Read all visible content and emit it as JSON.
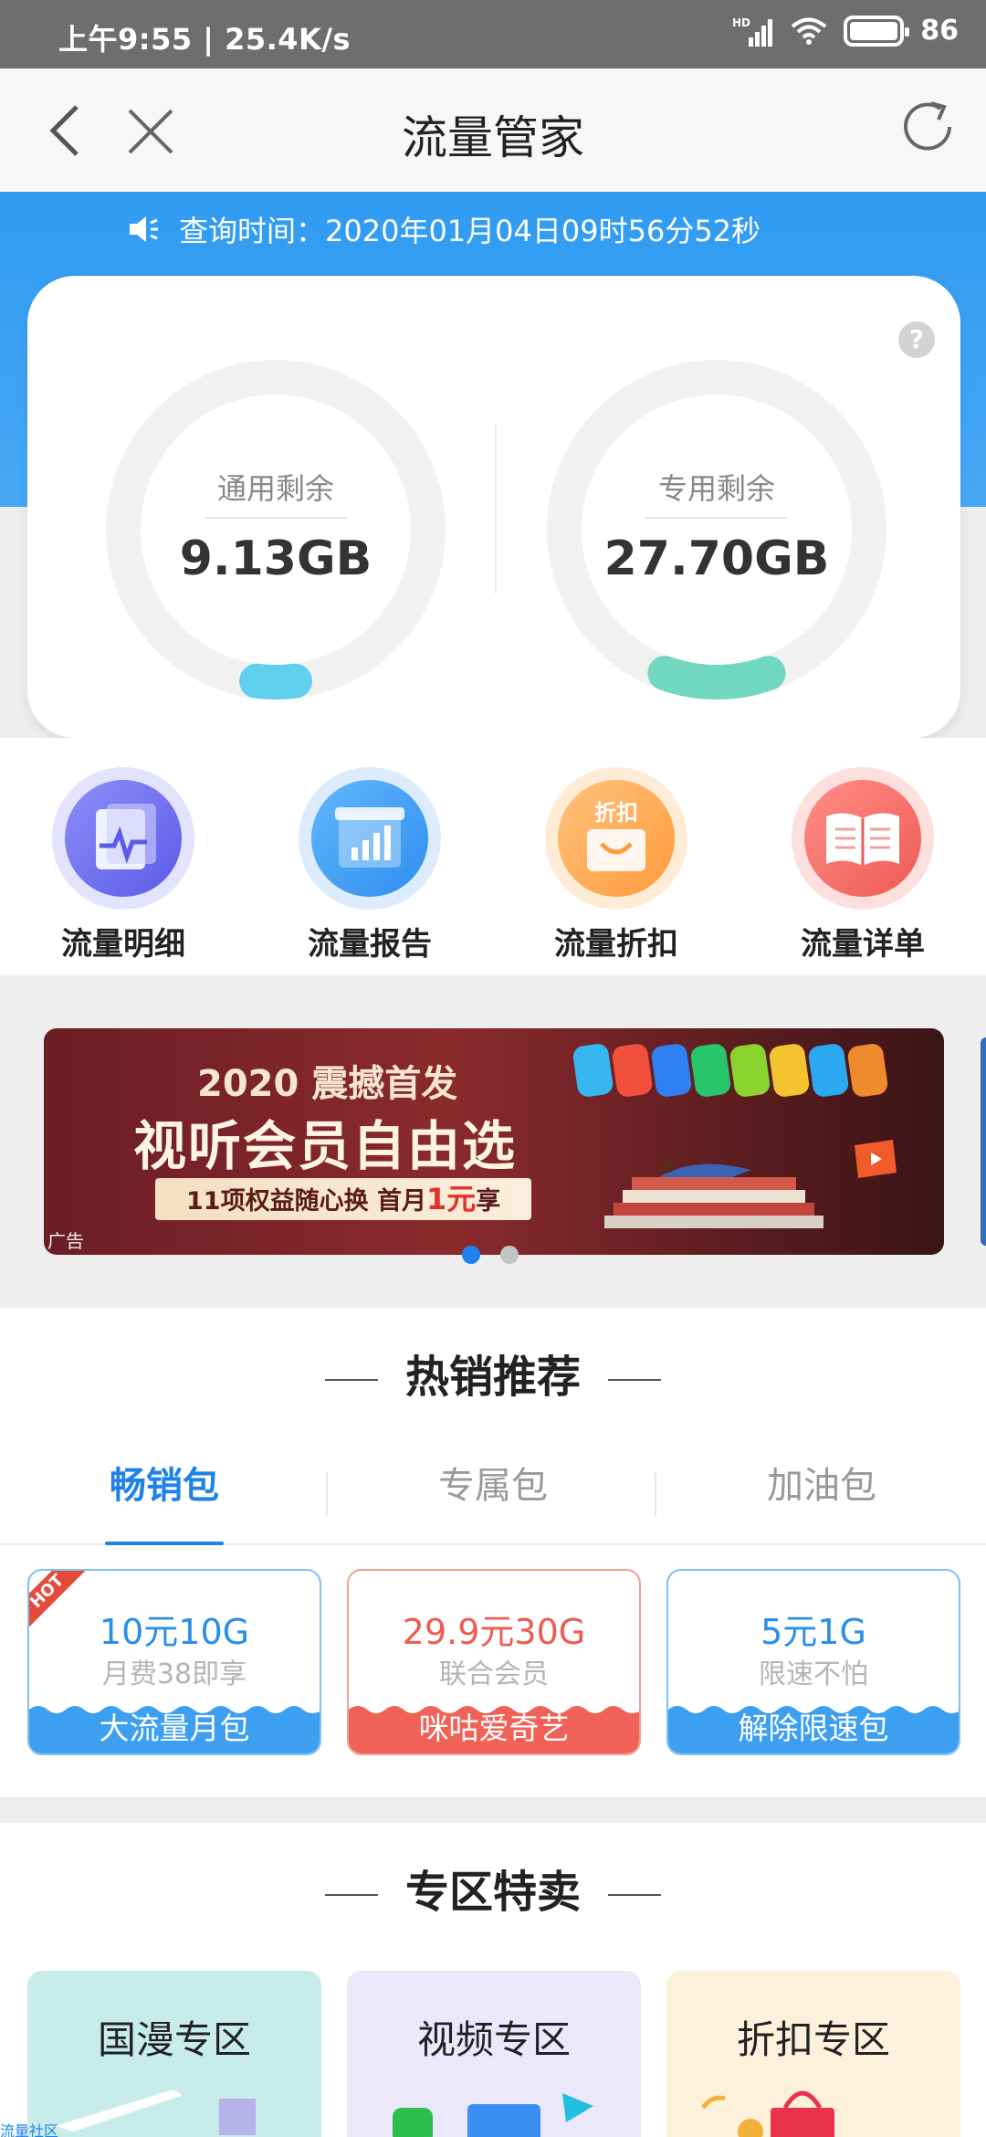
{
  "status_bar": {
    "time_speed": "上午9:55 | 25.4K/s",
    "battery": "86"
  },
  "title_bar": {
    "title": "流量管家"
  },
  "query": {
    "text": "查询时间：2020年01月04日09时56分52秒"
  },
  "gauges": [
    {
      "label": "通用剩余",
      "value": "9.13GB",
      "color": "#5fd0ee",
      "fraction": 0.04
    },
    {
      "label": "专用剩余",
      "value": "27.70GB",
      "color": "#72d8c0",
      "fraction": 0.11
    }
  ],
  "help_icon": "?",
  "quick_actions": [
    {
      "label": "流量明细",
      "icon": "heartbeat-doc-icon",
      "color": "#6b6ff0"
    },
    {
      "label": "流量报告",
      "icon": "bar-chart-icon",
      "color": "#3aa1f4"
    },
    {
      "label": "流量折扣",
      "icon": "discount-bag-icon",
      "badge": "折扣",
      "color": "#ffa74b"
    },
    {
      "label": "流量详单",
      "icon": "open-book-icon",
      "color": "#f7706b"
    }
  ],
  "banner": {
    "line1": "2020 震撼首发",
    "line2": "视听会员自由选",
    "line3_prefix": "11项权益随心换  首月",
    "line3_highlight": "1元",
    "line3_suffix": "享",
    "ad_label": "广告",
    "active_dot": 0
  },
  "hot": {
    "title": "热销推荐",
    "tabs": [
      "畅销包",
      "专属包",
      "加油包"
    ],
    "active_tab": 0,
    "packages": [
      {
        "price": "10元10G",
        "sub": "月费38即享",
        "footer": "大流量月包",
        "color": "#2a8fe6",
        "hot": "HOT"
      },
      {
        "price": "29.9元30G",
        "sub": "联合会员",
        "footer": "咪咕爱奇艺",
        "color": "#ef5b50"
      },
      {
        "price": "5元1G",
        "sub": "限速不怕",
        "footer": "解除限速包",
        "color": "#2a8fe6"
      }
    ]
  },
  "zone": {
    "title": "专区特卖",
    "cards": [
      {
        "title": "国漫专区",
        "bg": "#c8ece9"
      },
      {
        "title": "视频专区",
        "bg": "#ece7fb"
      },
      {
        "title": "折扣专区",
        "bg": "#fdf1dc"
      }
    ]
  },
  "corner_link": "流量社区"
}
